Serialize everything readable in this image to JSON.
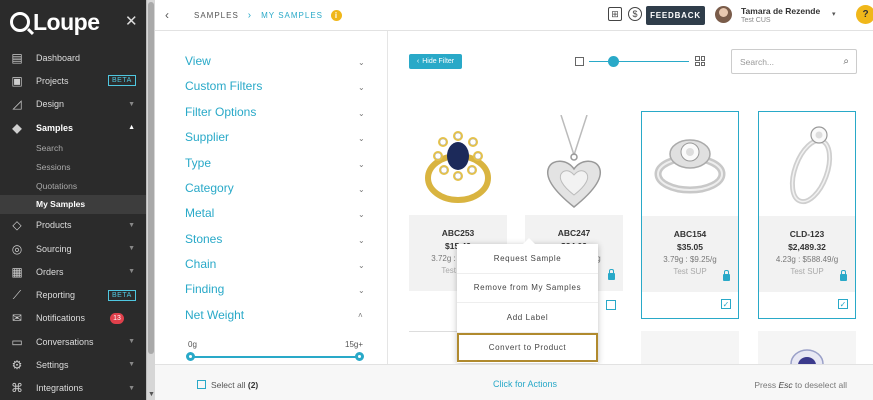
{
  "app": {
    "logo_text": "Loupe",
    "close_icon": "close-icon"
  },
  "sidebar": {
    "items": [
      {
        "label": "Dashboard",
        "icon": "dashboard-icon"
      },
      {
        "label": "Projects",
        "icon": "projects-icon",
        "badge": "BETA"
      },
      {
        "label": "Design",
        "icon": "design-icon",
        "caret": "▼"
      },
      {
        "label": "Samples",
        "icon": "diamond-icon",
        "caret": "▲",
        "active": true
      },
      {
        "label": "Products",
        "icon": "gem-icon",
        "caret": "▼"
      },
      {
        "label": "Sourcing",
        "icon": "globe-icon",
        "caret": "▼"
      },
      {
        "label": "Orders",
        "icon": "clipboard-icon",
        "caret": "▼"
      },
      {
        "label": "Reporting",
        "icon": "chart-icon",
        "badge": "BETA"
      },
      {
        "label": "Notifications",
        "icon": "envelope-icon",
        "count": "13"
      },
      {
        "label": "Conversations",
        "icon": "chat-icon",
        "caret": "▼"
      },
      {
        "label": "Settings",
        "icon": "gear-icon",
        "caret": "▼"
      },
      {
        "label": "Integrations",
        "icon": "integrations-icon",
        "caret": "▼"
      }
    ],
    "samples_sub": [
      "Search",
      "Sessions",
      "Quotations",
      "My Samples"
    ]
  },
  "topbar": {
    "crumb_root": "SAMPLES",
    "crumb_sep": "›",
    "crumb_current": "MY SAMPLES",
    "info": "i",
    "feedback": "FEEDBACK",
    "user_name": "Tamara de Rezende",
    "user_org": "Test CUS",
    "user_caret": "▾",
    "help": "?",
    "back": "‹"
  },
  "filters": {
    "items": [
      "View",
      "Custom Filters",
      "Filter Options",
      "Supplier",
      "Type",
      "Category",
      "Metal",
      "Stones",
      "Chain",
      "Finding",
      "Net Weight"
    ],
    "chev_down": "⌄",
    "chev_up": "˄",
    "net_weight_min": "0g",
    "net_weight_max": "15g+"
  },
  "toolbar": {
    "hide_filter": "Hide Filter",
    "search_placeholder": "Search..."
  },
  "cards": [
    {
      "code": "ABC253",
      "price": "$15.49",
      "weight": "3.72g : $4.16/g",
      "supplier": "Test SUP",
      "selected": false
    },
    {
      "code": "ABC247",
      "price": "$34.09",
      "weight": "5.32g : $6.41/g",
      "supplier": "Test SUP",
      "selected": false
    },
    {
      "code": "ABC154",
      "price": "$35.05",
      "weight": "3.79g : $9.25/g",
      "supplier": "Test SUP",
      "selected": true
    },
    {
      "code": "CLD-123",
      "price": "$2,489.32",
      "weight": "4.23g : $588.49/g",
      "supplier": "Test SUP",
      "selected": true
    }
  ],
  "menu": {
    "items": [
      "Request Sample",
      "Remove from My Samples",
      "Add Label",
      "Convert to Product"
    ]
  },
  "bottom": {
    "select_all": "Select all",
    "select_count": "(2)",
    "actions": "Click for Actions",
    "esc_pre": "Press",
    "esc_key": "Esc",
    "esc_post": "to deselect all"
  }
}
